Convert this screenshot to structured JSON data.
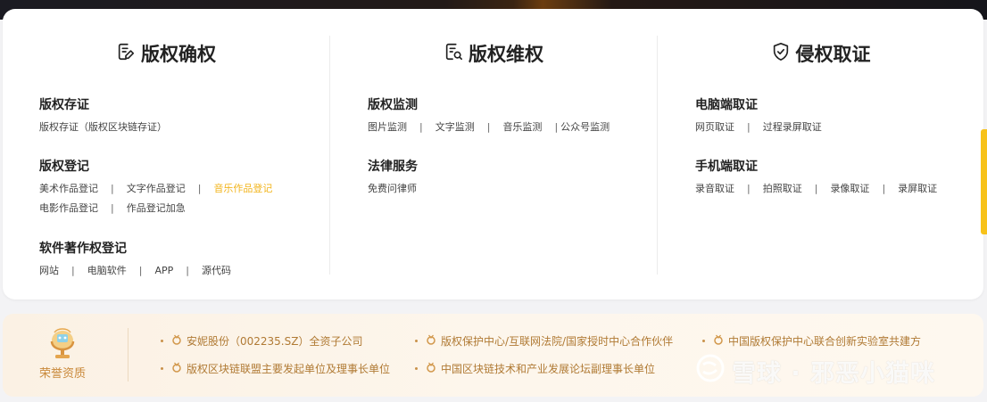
{
  "columns": [
    {
      "title": "版权确权",
      "icon": "certificate-edit-icon",
      "groups": [
        {
          "title": "版权存证",
          "rows": [
            [
              "版权存证（版权区块链存证）"
            ]
          ]
        },
        {
          "title": "版权登记",
          "rows": [
            [
              "美术作品登记",
              "文字作品登记",
              "音乐作品登记"
            ],
            [
              "电影作品登记",
              "作品登记加急"
            ]
          ]
        },
        {
          "title": "软件著作权登记",
          "rows": [
            [
              "网站",
              "电脑软件",
              "APP",
              "源代码"
            ]
          ]
        }
      ]
    },
    {
      "title": "版权维权",
      "icon": "document-check-icon",
      "groups": [
        {
          "title": "版权监测",
          "rows": [
            [
              "图片监测",
              "文字监测",
              "音乐监测",
              "公众号监测"
            ]
          ]
        },
        {
          "title": "法律服务",
          "rows": [
            [
              "免费问律师"
            ]
          ]
        }
      ]
    },
    {
      "title": "侵权取证",
      "icon": "shield-check-icon",
      "groups": [
        {
          "title": "电脑端取证",
          "rows": [
            [
              "网页取证",
              "过程录屏取证"
            ]
          ]
        },
        {
          "title": "手机端取证",
          "rows": [
            [
              "录音取证",
              "拍照取证",
              "录像取证",
              "录屏取证"
            ]
          ]
        }
      ]
    }
  ],
  "separator": "|",
  "active_link": "音乐作品登记",
  "honor": {
    "label": "荣誉资质",
    "items": [
      "安妮股份（002235.SZ）全资子公司",
      "版权保护中心/互联网法院/国家授时中心合作伙伴",
      "中国版权保护中心联合创新实验室共建方",
      "版权区块链联盟主要发起单位及理事长单位",
      "中国区块链技术和产业发展论坛副理事长单位"
    ]
  },
  "watermark": "雪球 · 邪恶小猫咪",
  "colors": {
    "accent": "#f2b41c",
    "honor_text": "#b07a34",
    "card_bg": "#ffffff",
    "page_bg": "#f3f3f5"
  }
}
